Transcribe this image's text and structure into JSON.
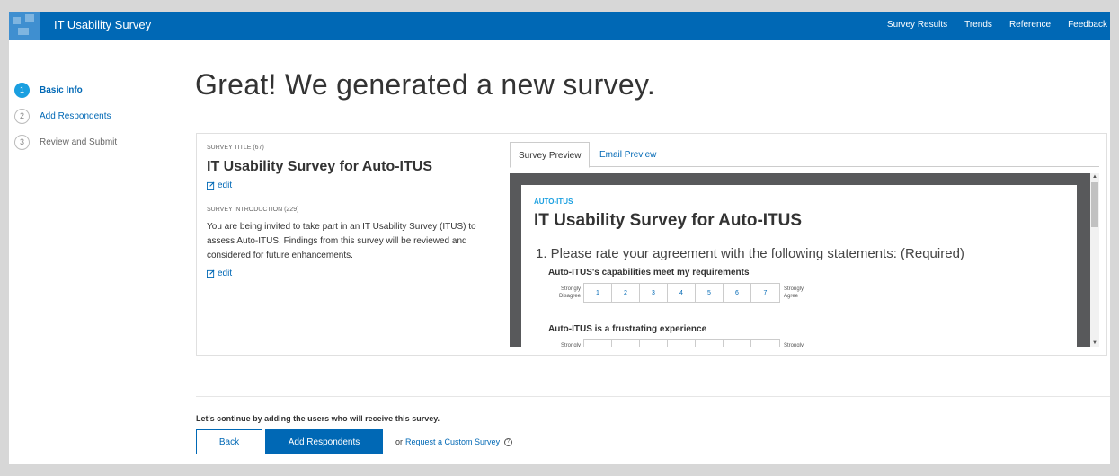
{
  "header": {
    "app_title": "IT Usability Survey",
    "nav": [
      "Survey Results",
      "Trends",
      "Reference",
      "Feedback"
    ]
  },
  "steps": [
    {
      "num": "1",
      "label": "Basic Info",
      "state": "active"
    },
    {
      "num": "2",
      "label": "Add Respondents",
      "state": "link"
    },
    {
      "num": "3",
      "label": "Review and Submit",
      "state": "muted"
    }
  ],
  "page_title": "Great! We generated a new survey.",
  "details": {
    "title_label": "SURVEY TITLE (67)",
    "title": "IT Usability Survey for Auto-ITUS",
    "edit_label": "edit",
    "intro_label": "SURVEY INTRODUCTION (229)",
    "intro_text": "You are being invited to take part in an IT Usability Survey (ITUS) to assess Auto-ITUS. Findings from this survey will be reviewed and considered for future enhancements."
  },
  "tabs": [
    "Survey Preview",
    "Email Preview"
  ],
  "preview": {
    "brand": "AUTO-ITUS",
    "title": "IT Usability Survey for Auto-ITUS",
    "question": "1. Please rate your agreement with the following statements: (Required)",
    "statements": [
      "Auto-ITUS's capabilities meet my requirements",
      "Auto-ITUS is a frustrating experience"
    ],
    "scale_left": "Strongly Disagree",
    "scale_right": "Strongly Agree",
    "scale_values": [
      "1",
      "2",
      "3",
      "4",
      "5",
      "6",
      "7"
    ]
  },
  "footer": {
    "continue_text": "Let's continue by adding the users who will receive this survey.",
    "back_label": "Back",
    "add_label": "Add Respondents",
    "or_text": "or",
    "custom_link": "Request a Custom Survey",
    "help_glyph": "?"
  },
  "colors": {
    "brand": "#0068b5",
    "accent": "#1a9fe0"
  }
}
